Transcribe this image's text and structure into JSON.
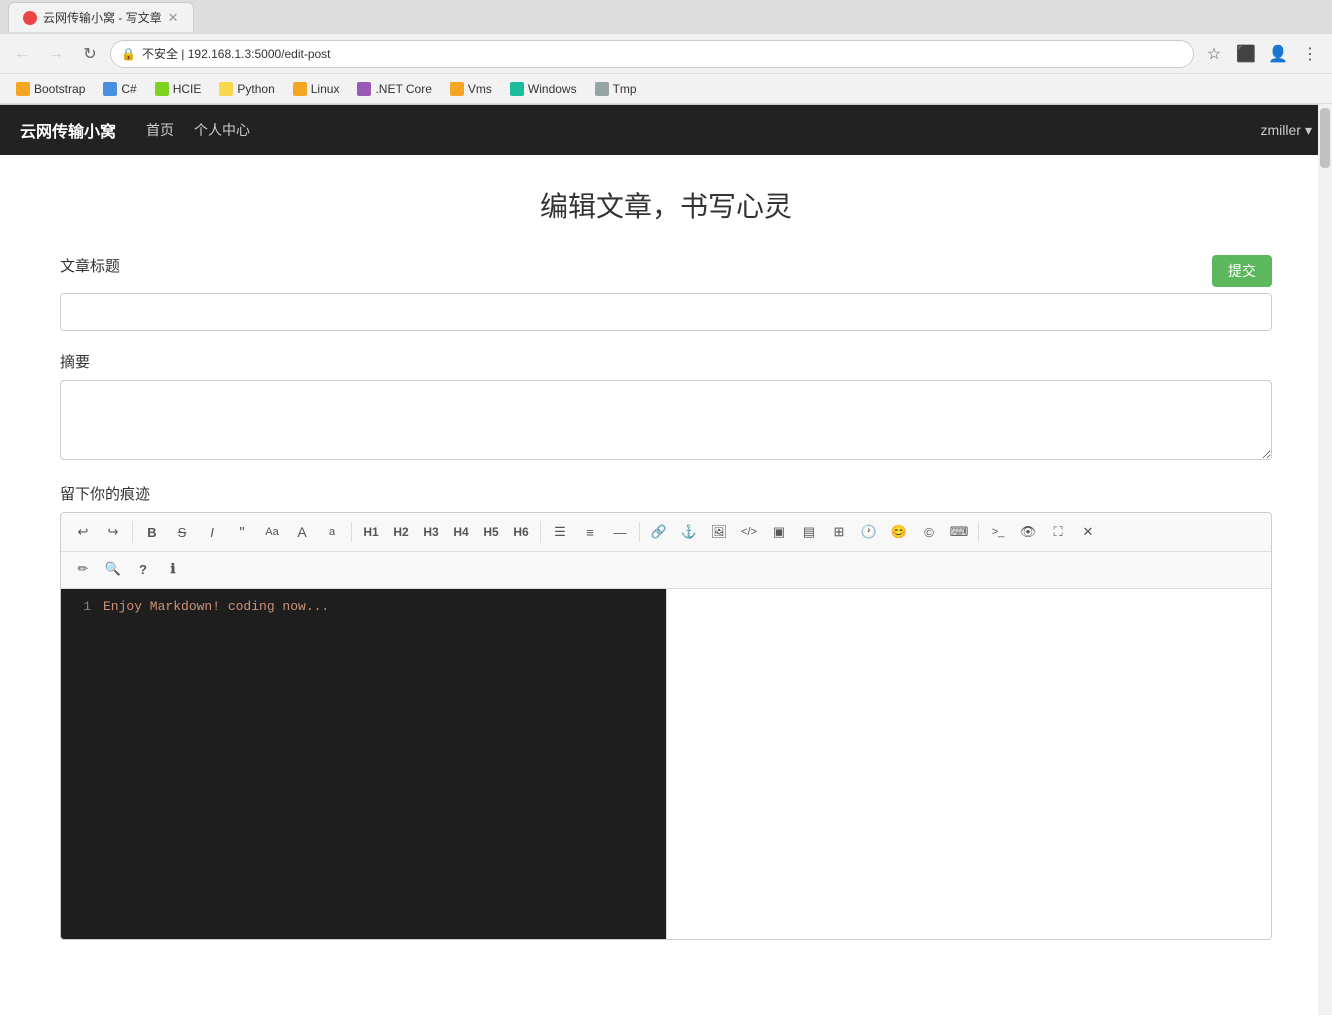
{
  "browser": {
    "tab_title": "云网传输小窝 - 写文章",
    "address": "192.168.1.3:5000/edit-post",
    "address_display": "不安全 | 192.168.1.3:5000/edit-post",
    "back_btn": "←",
    "forward_btn": "→",
    "reload_btn": "↻"
  },
  "bookmarks": [
    {
      "label": "Bootstrap",
      "color": "bm-orange"
    },
    {
      "label": "C#",
      "color": "bm-blue"
    },
    {
      "label": "HCIE",
      "color": "bm-green"
    },
    {
      "label": "Python",
      "color": "bm-yellow"
    },
    {
      "label": "Linux",
      "color": "bm-orange"
    },
    {
      "label": ".NET Core",
      "color": "bm-purple"
    },
    {
      "label": "Vms",
      "color": "bm-orange"
    },
    {
      "label": "Windows",
      "color": "bm-teal"
    },
    {
      "label": "Tmp",
      "color": "bm-gray"
    }
  ],
  "nav": {
    "brand": "云网传输小窝",
    "links": [
      "首页",
      "个人中心"
    ],
    "user": "zmiller"
  },
  "page": {
    "title": "编辑文章，书写心灵",
    "title_label": "文章标题",
    "summary_label": "摘要",
    "editor_label": "留下你的痕迹",
    "submit_btn": "提交",
    "title_placeholder": "",
    "summary_placeholder": "",
    "editor_placeholder": "Enjoy Markdown! coding now..."
  },
  "toolbar": {
    "undo": "↩",
    "redo": "↪",
    "bold": "B",
    "strikethrough": "S",
    "italic": "I",
    "quote": "❝",
    "font_larger": "Aa",
    "font_large": "A",
    "font_small": "a",
    "h1": "H1",
    "h2": "H2",
    "h3": "H3",
    "h4": "H4",
    "h5": "H5",
    "h6": "H6",
    "ul": "☰",
    "ol": "≡",
    "hr": "—",
    "link": "🔗",
    "anchor": "⚓",
    "image": "🖼",
    "code_inline": "</>",
    "code_block1": "▣",
    "code_block2": "▤",
    "table": "⊞",
    "clock": "🕐",
    "emoji": "😊",
    "copyright": "©",
    "keyboard": "⌨",
    "terminal": ">_",
    "preview": "👁",
    "fullscreen": "⛶",
    "close": "✕",
    "pen": "✏",
    "search": "🔍",
    "help": "?",
    "info": "ℹ"
  },
  "editor": {
    "line_number": "1",
    "line_content": "Enjoy Markdown! coding now..."
  }
}
